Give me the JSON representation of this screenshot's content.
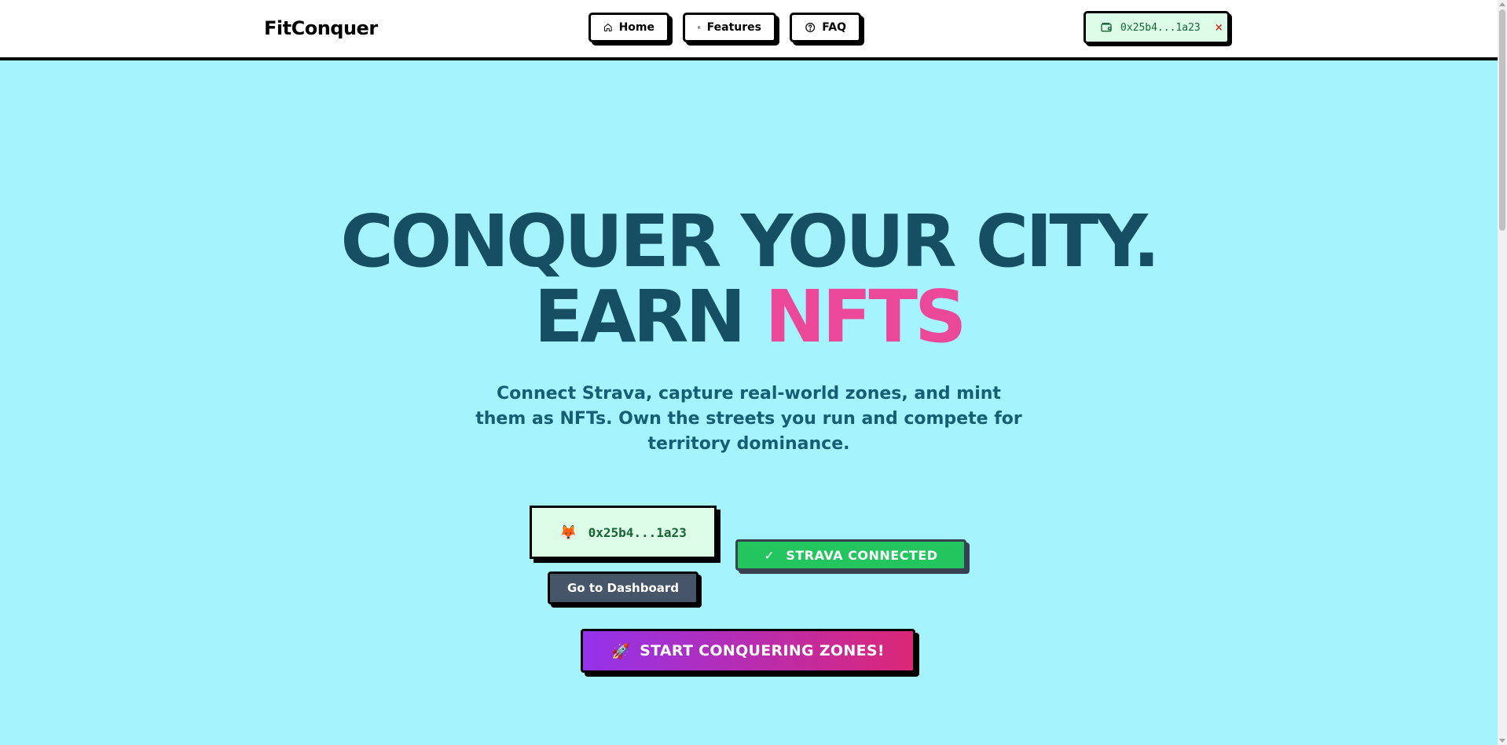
{
  "header": {
    "logo": "FitConquer",
    "nav": [
      {
        "label": "Home",
        "icon": "home-icon"
      },
      {
        "label": "Features",
        "icon": "grid-icon"
      },
      {
        "label": "FAQ",
        "icon": "question-icon"
      }
    ],
    "wallet": {
      "address": "0x25b4...1a23",
      "disconnect_label": "×",
      "icon": "wallet-icon"
    }
  },
  "hero": {
    "line1": "CONQUER YOUR CITY.",
    "line2_prefix": "EARN",
    "line2_highlight": "NFTS",
    "subtitle": "Connect Strava, capture real-world zones, and mint them as NFTs. Own the streets you run and compete for territory dominance."
  },
  "actions": {
    "wallet_icon": "🦊",
    "wallet_address": "0x25b4...1a23",
    "strava_label": "STRAVA CONNECTED",
    "strava_check": "✓",
    "dashboard_label": "Go to Dashboard",
    "start_icon": "🚀",
    "start_label": "START CONQUERING ZONES!"
  },
  "colors": {
    "background": "#a5f3fc",
    "heading": "#164e63",
    "accent_pink": "#ec4899",
    "strava_green": "#22c55e",
    "start_gradient_from": "#9333ea",
    "start_gradient_to": "#db2777"
  }
}
